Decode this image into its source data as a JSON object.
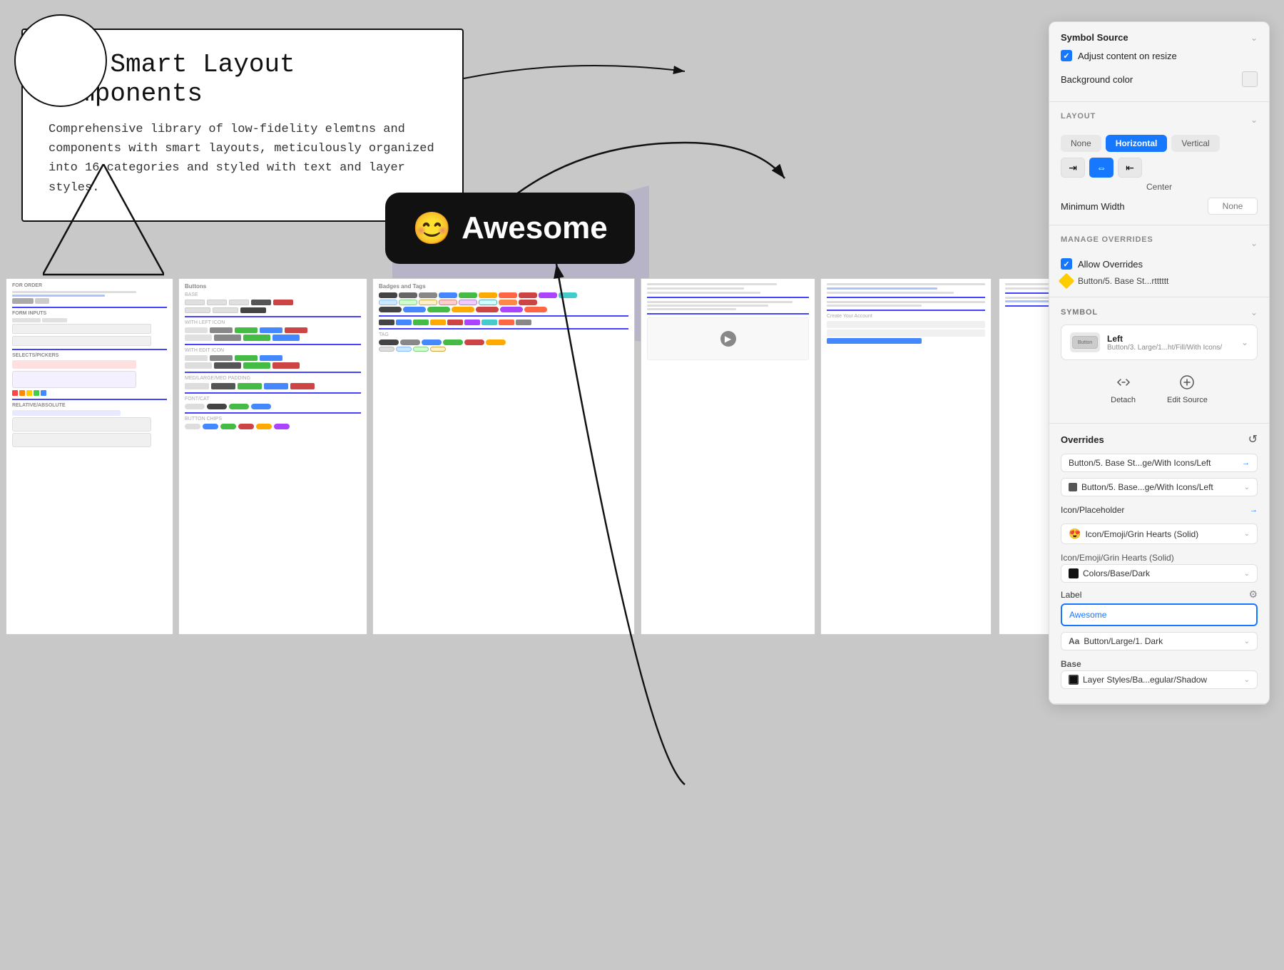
{
  "canvas": {
    "bg_color": "#d0d0d0"
  },
  "annotation": {
    "title": "632 Smart Layout Components",
    "description": "Comprehensive library of low-fidelity elemtns and components with smart layouts, meticulously organized into 16 categories and styled with text and layer styles."
  },
  "awesome_badge": {
    "emoji": "😊",
    "text": "Awesome"
  },
  "symbol_source_panel": {
    "title": "Symbol Source",
    "adjust_content_label": "Adjust content on resize",
    "bg_color_label": "Background color",
    "layout_section": "LAYOUT",
    "layout_none": "None",
    "layout_horizontal": "Horizontal",
    "layout_vertical": "Vertical",
    "align_center": "Center",
    "min_width_label": "Minimum Width",
    "min_width_placeholder": "None",
    "manage_overrides": "MANAGE OVERRIDES",
    "allow_overrides": "Allow Overrides",
    "button_base_label": "Button/5. Base St...rtttttt"
  },
  "symbol_panel": {
    "header": "SYMBOL",
    "name": "Left",
    "path": "Button/3. Large/1...ht/Fill/With Icons/",
    "detach_label": "Detach",
    "edit_source_label": "Edit Source",
    "overrides_title": "Overrides",
    "overrides_items": [
      {
        "label": "",
        "text": "Button/5. Base St...ge/With Icons/Left",
        "has_arrow": true,
        "type": "link"
      },
      {
        "label": "",
        "text": "Button/5. Base...ge/With Icons/Left",
        "has_arrow": true,
        "type": "link",
        "has_swatch": true,
        "swatch_color": "#555555"
      },
      {
        "label": "Icon/Placeholder",
        "text": "",
        "type": "link",
        "has_arrow": true
      },
      {
        "label": "",
        "text": "Icon/Emoji/Grin Hearts (Solid)",
        "type": "dropdown",
        "has_dropdown": true
      },
      {
        "label": "Icon/Emoji/Grin Hearts (Solid)",
        "text": "",
        "type": "header_only"
      },
      {
        "label": "",
        "text": "Colors/Base/Dark",
        "type": "dropdown",
        "has_swatch": true,
        "swatch_color": "#111111",
        "has_dropdown": true
      },
      {
        "label": "Label",
        "text": "Awesome",
        "type": "active_input",
        "has_settings": true
      },
      {
        "label": "",
        "text": "Button/Large/1. Dark",
        "type": "dropdown",
        "prefix": "Aa",
        "has_dropdown": true
      },
      {
        "label": "Base",
        "text": "",
        "type": "header_only"
      },
      {
        "label": "",
        "text": "Layer Styles/Ba...egular/Shadow",
        "type": "dropdown",
        "has_swatch": true,
        "swatch_color": "#111111",
        "has_dropdown": true
      }
    ]
  },
  "thumbnails": {
    "section_labels": [
      "For_Order",
      "Buttons",
      "Badges and Tags",
      "FONT",
      "BUTTON CHIPS"
    ]
  }
}
